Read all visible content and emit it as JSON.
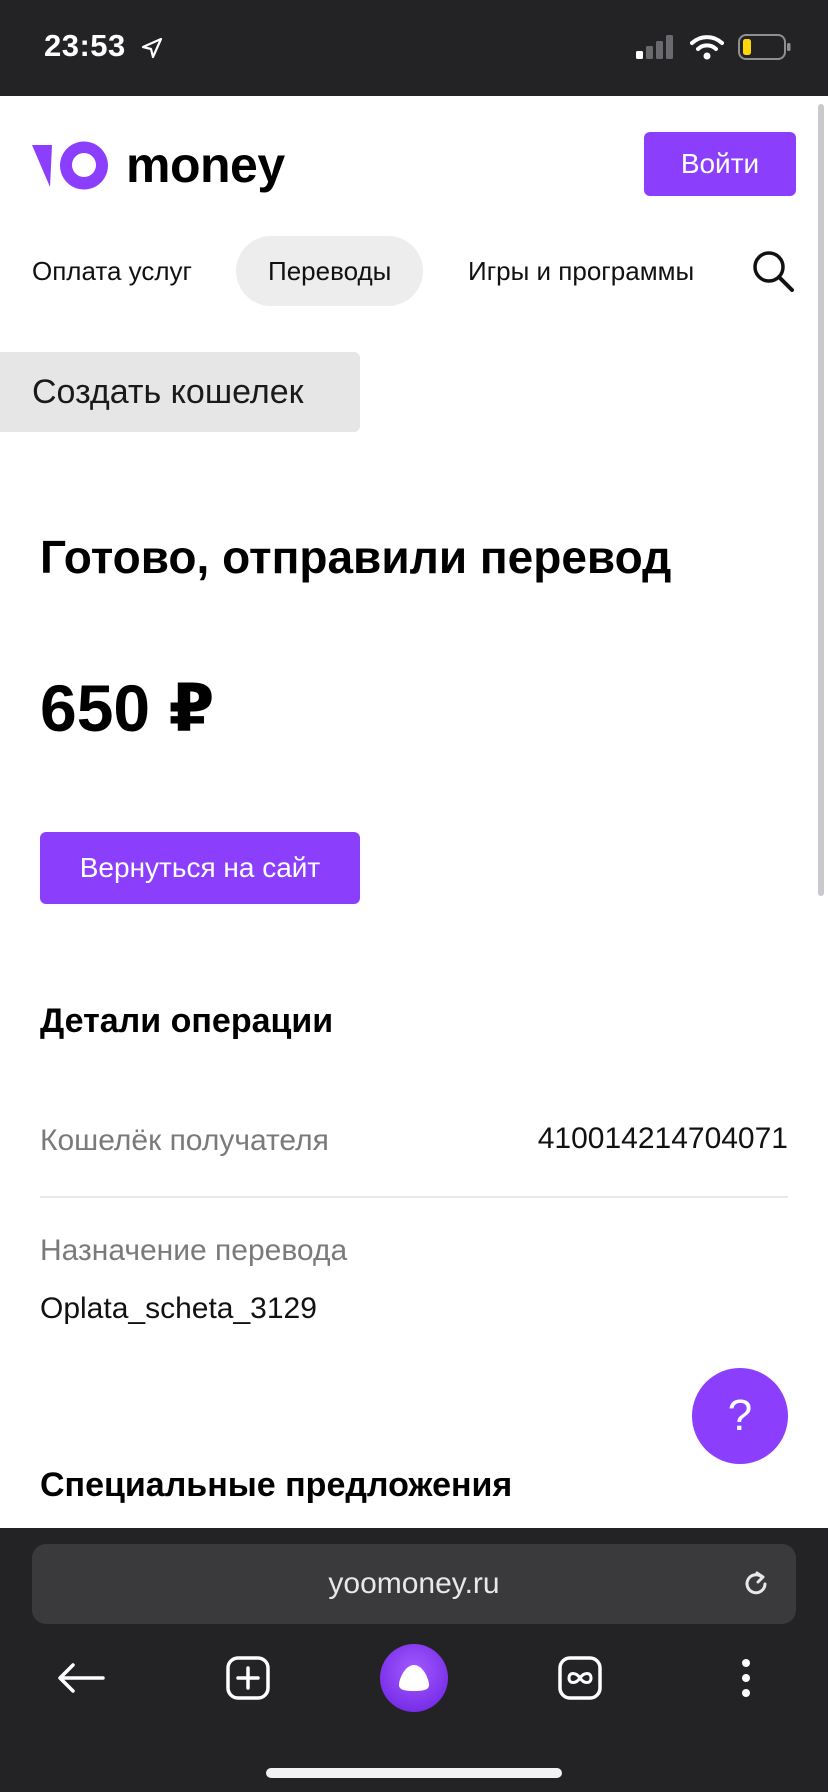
{
  "status_bar": {
    "time": "23:53",
    "icons": [
      "location-arrow-icon",
      "cellular-signal-icon",
      "wifi-icon",
      "battery-low-icon"
    ]
  },
  "header": {
    "logo_text": "money",
    "login_label": "Войти"
  },
  "nav": {
    "items": [
      {
        "label": "Оплата услуг",
        "active": false
      },
      {
        "label": "Переводы",
        "active": true
      },
      {
        "label": "Игры и программы",
        "active": false
      }
    ],
    "search_icon": "search-icon"
  },
  "create_wallet_label": "Создать кошелек",
  "result": {
    "title": "Готово, отправили перевод",
    "amount": "650 ₽",
    "return_label": "Вернуться на сайт"
  },
  "details": {
    "title": "Детали операции",
    "recipient_wallet_label": "Кошелёк получателя",
    "recipient_wallet_value": "410014214704071",
    "purpose_label": "Назначение перевода",
    "purpose_value": "Oplata_scheta_3129"
  },
  "help_label": "?",
  "offers_title": "Специальные предложения",
  "browser": {
    "url": "yoomoney.ru",
    "toolbar_icons": [
      "back-arrow-icon",
      "new-tab-icon",
      "alice-icon",
      "tabs-icon",
      "more-icon"
    ]
  },
  "colors": {
    "accent": "#8b3ffd",
    "status_bar_bg": "#232325",
    "battery_level": "#ffd60a"
  }
}
